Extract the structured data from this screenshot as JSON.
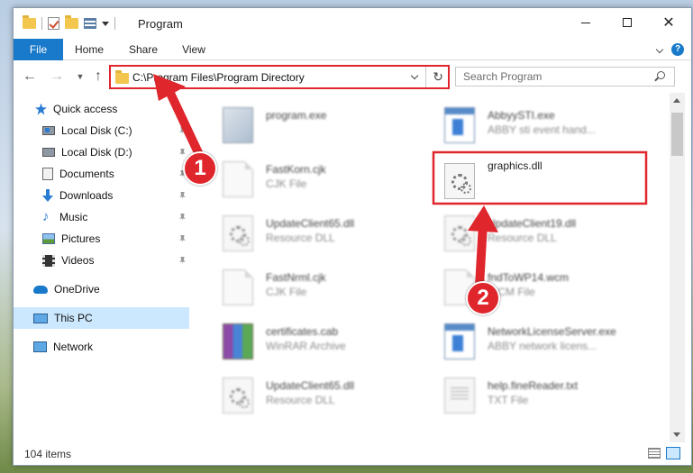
{
  "window": {
    "title": "Program",
    "minimize_glyph": "",
    "close_glyph": "✕"
  },
  "ribbon": {
    "tabs": [
      "File",
      "Home",
      "Share",
      "View"
    ],
    "help": "?"
  },
  "nav": {
    "back": "←",
    "forward": "→",
    "recent": "▼",
    "up": "↑",
    "address": "C:\\Program Files\\Program Directory",
    "refresh": "↻",
    "search_placeholder": "Search Program"
  },
  "sidebar": {
    "items": [
      {
        "label": "Quick access",
        "icon": "star-icon"
      },
      {
        "label": "Local Disk (C:)",
        "icon": "drive-icon",
        "pinned": true
      },
      {
        "label": "Local Disk (D:)",
        "icon": "drive-icon",
        "pinned": true
      },
      {
        "label": "Documents",
        "icon": "documents-icon",
        "pinned": true
      },
      {
        "label": "Downloads",
        "icon": "downloads-icon",
        "pinned": true
      },
      {
        "label": "Music",
        "icon": "music-icon",
        "pinned": true
      },
      {
        "label": "Pictures",
        "icon": "pictures-icon",
        "pinned": true
      },
      {
        "label": "Videos",
        "icon": "videos-icon",
        "pinned": true
      },
      {
        "label": "OneDrive",
        "icon": "cloud-icon"
      },
      {
        "label": "This PC",
        "icon": "computer-icon",
        "selected": true
      },
      {
        "label": "Network",
        "icon": "network-icon"
      }
    ]
  },
  "files": [
    {
      "name": "program.exe",
      "type": "",
      "icon": "exe-icon"
    },
    {
      "name": "AbbyySTI.exe",
      "type": "ABBY sti event hand...",
      "icon": "app-icon"
    },
    {
      "name": "FastKorn.cjk",
      "type": "CJK File",
      "icon": "file-icon"
    },
    {
      "name": "graphics.dll",
      "type": "",
      "icon": "dll-icon",
      "highlighted": true
    },
    {
      "name": "UpdateClient65.dll",
      "type": "Resource DLL",
      "icon": "dll-icon"
    },
    {
      "name": "UpdateClient19.dll",
      "type": "Resource DLL",
      "icon": "dll-icon"
    },
    {
      "name": "FastNrml.cjk",
      "type": "CJK File",
      "icon": "file-icon"
    },
    {
      "name": "fndToWP14.wcm",
      "type": "WCM File",
      "icon": "file-icon"
    },
    {
      "name": "certificates.cab",
      "type": "WinRAR Archive",
      "icon": "archive-icon"
    },
    {
      "name": "NetworkLicenseServer.exe",
      "type": "ABBY network licens...",
      "icon": "app-icon"
    },
    {
      "name": "UpdateClient65.dll",
      "type": "Resource DLL",
      "icon": "dll-icon"
    },
    {
      "name": "help.fineReader.txt",
      "type": "TXT File",
      "icon": "text-file-icon"
    }
  ],
  "status": {
    "item_count": "104 items"
  },
  "annotations": [
    {
      "label": "1"
    },
    {
      "label": "2"
    }
  ],
  "colors": {
    "accent": "#1979ca",
    "annotation_red": "#e0262d",
    "selected_bg": "#cce8ff"
  }
}
